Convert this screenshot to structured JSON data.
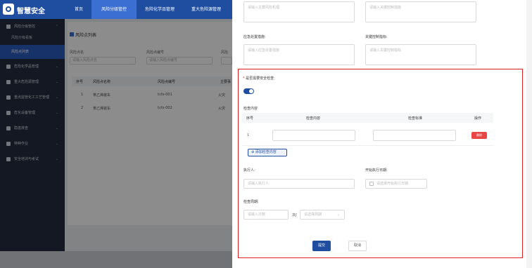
{
  "app": {
    "title": "智慧安全"
  },
  "top_nav": [
    "首页",
    "风险分级管控",
    "危险化学品管理",
    "重大危险源管理"
  ],
  "sidebar": {
    "items": [
      {
        "label": "风险分级管控",
        "expanded": true
      },
      {
        "label": "危险化学品管理"
      },
      {
        "label": "重大危险源管理"
      },
      {
        "label": "重点监管化工工艺管理"
      },
      {
        "label": "危化设备管理"
      },
      {
        "label": "隐患排查"
      },
      {
        "label": "特种作业"
      },
      {
        "label": "安全培训与考试"
      }
    ],
    "subitems": [
      "风险分级看板",
      "风险点列表"
    ]
  },
  "list": {
    "title": "风险点列表",
    "filters": [
      {
        "label": "风险点名",
        "placeholder": "请输入风险点名"
      },
      {
        "label": "风险点编号",
        "placeholder": "请输入风险点编号"
      },
      {
        "label": "风险"
      }
    ],
    "columns": [
      "序号",
      "风险点名称",
      "风险点编号",
      "主要事"
    ],
    "rows": [
      [
        "1",
        "苯乙烯装车",
        "tcfx-001",
        "火灾"
      ],
      [
        "2",
        "苯乙烯装车",
        "tcfx-002",
        "火灾"
      ]
    ]
  },
  "drawer": {
    "top_fields": [
      {
        "placeholder": "请输入主要风险机理"
      },
      {
        "placeholder": "请输入关键控制措施"
      }
    ],
    "emergency_label": "应急处置措施:",
    "emergency_placeholder": "请输入应急处置措施",
    "key_control_label": "关键控制指标:",
    "key_control_placeholder": "请输入关键控制指标",
    "safety_check_label": "是否需要安全检查:",
    "safety_check_on": true,
    "check_content_title": "检查内容",
    "check_columns": [
      "序号",
      "检查内容",
      "检查标准",
      "操作"
    ],
    "check_rows": [
      {
        "index": "1",
        "delete_label": "删除"
      }
    ],
    "add_label": "添加检查内容",
    "executor_label": "执行人:",
    "executor_placeholder": "请输入执行人",
    "start_date_label": "开始执行日期:",
    "start_date_placeholder": "请选择开始执行日期",
    "cycle_label": "检查周期:",
    "cycle_count_placeholder": "请输入次数",
    "cycle_sep": "次/",
    "cycle_unit_placeholder": "请选择周期",
    "submit_label": "提交",
    "cancel_label": "取消"
  }
}
